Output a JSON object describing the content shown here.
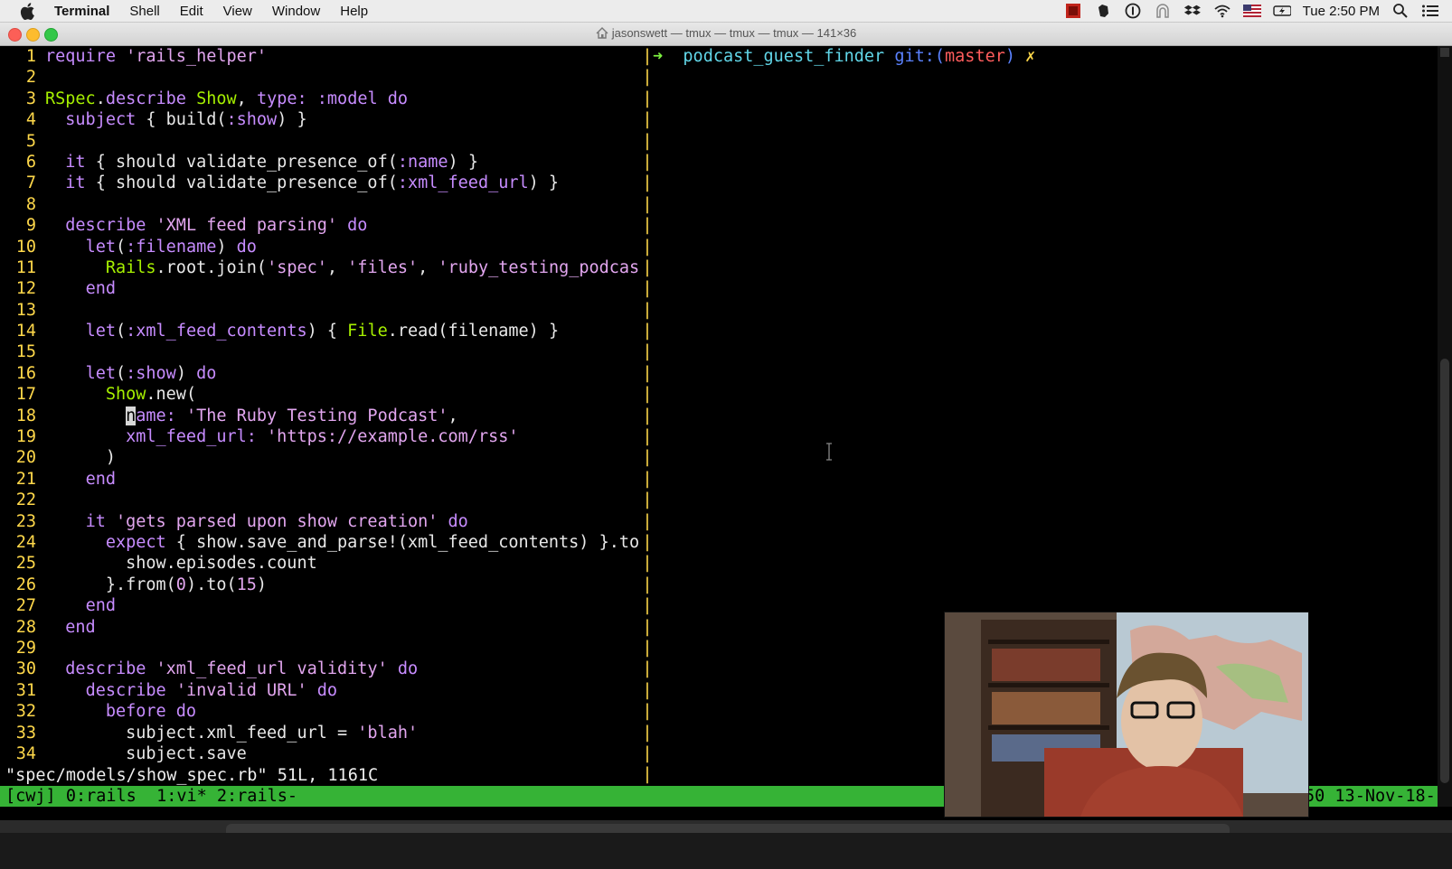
{
  "menubar": {
    "app_name": "Terminal",
    "items": [
      "Shell",
      "Edit",
      "View",
      "Window",
      "Help"
    ],
    "clock": "Tue 2:50 PM"
  },
  "window": {
    "title": "jasonswett — tmux — tmux — tmux — 141×36"
  },
  "editor": {
    "lines": [
      {
        "n": "1"
      },
      {
        "n": "2"
      },
      {
        "n": "3"
      },
      {
        "n": "4"
      },
      {
        "n": "5"
      },
      {
        "n": "6"
      },
      {
        "n": "7"
      },
      {
        "n": "8"
      },
      {
        "n": "9"
      },
      {
        "n": "10"
      },
      {
        "n": "11"
      },
      {
        "n": "12"
      },
      {
        "n": "13"
      },
      {
        "n": "14"
      },
      {
        "n": "15"
      },
      {
        "n": "16"
      },
      {
        "n": "17"
      },
      {
        "n": "18"
      },
      {
        "n": "19"
      },
      {
        "n": "20"
      },
      {
        "n": "21"
      },
      {
        "n": "22"
      },
      {
        "n": "23"
      },
      {
        "n": "24"
      },
      {
        "n": "25"
      },
      {
        "n": "26"
      },
      {
        "n": "27"
      },
      {
        "n": "28"
      },
      {
        "n": "29"
      },
      {
        "n": "30"
      },
      {
        "n": "31"
      },
      {
        "n": "32"
      },
      {
        "n": "33"
      },
      {
        "n": "34"
      }
    ],
    "code": {
      "l1_kw": "require",
      "l1_str": "'rails_helper'",
      "l3_a": "RSpec",
      "l3_b": ".",
      "l3_c": "describe",
      "l3_d": " ",
      "l3_e": "Show",
      "l3_f": ", ",
      "l3_g": "type:",
      "l3_h": " ",
      "l3_i": ":model",
      "l3_j": " ",
      "l3_k": "do",
      "l4_a": "  ",
      "l4_b": "subject",
      "l4_c": " { build(",
      "l4_d": ":show",
      "l4_e": ") }",
      "l6_a": "  ",
      "l6_b": "it",
      "l6_c": " { should validate_presence_of(",
      "l6_d": ":name",
      "l6_e": ") }",
      "l7_a": "  ",
      "l7_b": "it",
      "l7_c": " { should validate_presence_of(",
      "l7_d": ":xml_feed_url",
      "l7_e": ") }",
      "l9_a": "  ",
      "l9_b": "describe",
      "l9_c": " ",
      "l9_d": "'XML feed parsing'",
      "l9_e": " ",
      "l9_f": "do",
      "l10_a": "    ",
      "l10_b": "let",
      "l10_c": "(",
      "l10_d": ":filename",
      "l10_e": ") ",
      "l10_f": "do",
      "l11_a": "      ",
      "l11_b": "Rails",
      "l11_c": ".root.join(",
      "l11_d": "'spec'",
      "l11_e": ", ",
      "l11_f": "'files'",
      "l11_g": ", ",
      "l11_h": "'ruby_testing_podcas",
      "l12_a": "    ",
      "l12_b": "end",
      "l14_a": "    ",
      "l14_b": "let",
      "l14_c": "(",
      "l14_d": ":xml_feed_contents",
      "l14_e": ") { ",
      "l14_f": "File",
      "l14_g": ".read(filename) }",
      "l16_a": "    ",
      "l16_b": "let",
      "l16_c": "(",
      "l16_d": ":show",
      "l16_e": ") ",
      "l16_f": "do",
      "l17_a": "      ",
      "l17_b": "Show",
      "l17_c": ".new(",
      "l18_a": "        ",
      "l18_cur": "n",
      "l18_b": "ame:",
      "l18_c": " ",
      "l18_d": "'The Ruby Testing Podcast'",
      "l18_e": ",",
      "l19_a": "        ",
      "l19_b": "xml_feed_url:",
      "l19_c": " ",
      "l19_d": "'https://example.com/rss'",
      "l20_a": "      )",
      "l21_a": "    ",
      "l21_b": "end",
      "l23_a": "    ",
      "l23_b": "it",
      "l23_c": " ",
      "l23_d": "'gets parsed upon show creation'",
      "l23_e": " ",
      "l23_f": "do",
      "l24_a": "      ",
      "l24_b": "expect",
      "l24_c": " { show.save_and_parse!(xml_feed_contents) }.to",
      "l25_a": "        show.episodes.count",
      "l26_a": "      }.from(",
      "l26_b": "0",
      "l26_c": ").to(",
      "l26_d": "15",
      "l26_e": ")",
      "l27_a": "    ",
      "l27_b": "end",
      "l28_a": "  ",
      "l28_b": "end",
      "l30_a": "  ",
      "l30_b": "describe",
      "l30_c": " ",
      "l30_d": "'xml_feed_url validity'",
      "l30_e": " ",
      "l30_f": "do",
      "l31_a": "    ",
      "l31_b": "describe",
      "l31_c": " ",
      "l31_d": "'invalid URL'",
      "l31_e": " ",
      "l31_f": "do",
      "l32_a": "      ",
      "l32_b": "before",
      "l32_c": " ",
      "l32_d": "do",
      "l33_a": "        subject.xml_feed_url = ",
      "l33_b": "'blah'",
      "l34_a": "        subject.save"
    },
    "file_info": "\"spec/models/show_spec.rb\" 51L, 1161C"
  },
  "shell": {
    "arrow": "➜",
    "dir": "podcast_guest_finder",
    "git_label": "git:(",
    "branch": "master",
    "git_close": ")",
    "dirty": "✗"
  },
  "tmux": {
    "left": "[cwj] 0:rails  1:vi* 2:rails-",
    "right": "50 13-Nov-18-"
  },
  "colors": {
    "tmux_status": "#36b336",
    "line_number": "#ffd84a",
    "keyword": "#c78cff",
    "constant": "#a6f000",
    "prompt_arrow": "#7cf040",
    "prompt_dir": "#61d6e8",
    "git_branch": "#ff5d5d"
  }
}
